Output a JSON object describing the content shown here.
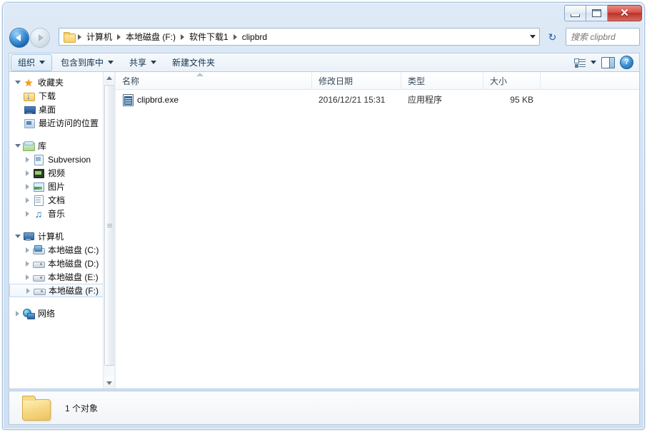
{
  "window": {
    "controls": {
      "minimize": "–",
      "maximize": "□",
      "close": "✕"
    }
  },
  "nav": {
    "back_label": "后退",
    "forward_label": "前进",
    "recent_pages_label": "最近浏览的页面",
    "refresh_label": "刷新",
    "refresh_glyph": "↻",
    "breadcrumb": [
      "计算机",
      "本地磁盘 (F:)",
      "软件下载1",
      "clipbrd"
    ],
    "address_dropdown_label": "地址下拉"
  },
  "search": {
    "placeholder": "搜索 clipbrd",
    "value": ""
  },
  "toolbar": {
    "organize": "组织",
    "include_in_library": "包含到库中",
    "share": "共享",
    "new_folder": "新建文件夹",
    "view_label": "视图",
    "preview_pane_label": "预览窗格",
    "help_label": "?"
  },
  "sidebar": {
    "groups": [
      {
        "header": {
          "label": "收藏夹",
          "icon": "star-icon",
          "expanded": true
        },
        "items": [
          {
            "label": "下载",
            "icon": "download-folder-icon",
            "expandable": false
          },
          {
            "label": "桌面",
            "icon": "desktop-icon",
            "expandable": false
          },
          {
            "label": "最近访问的位置",
            "icon": "recent-places-icon",
            "expandable": false
          }
        ]
      },
      {
        "header": {
          "label": "库",
          "icon": "library-icon",
          "expanded": true
        },
        "items": [
          {
            "label": "Subversion",
            "icon": "subversion-icon",
            "expandable": true
          },
          {
            "label": "视频",
            "icon": "video-icon",
            "expandable": true
          },
          {
            "label": "图片",
            "icon": "picture-icon",
            "expandable": true
          },
          {
            "label": "文档",
            "icon": "document-icon",
            "expandable": true
          },
          {
            "label": "音乐",
            "icon": "music-icon",
            "expandable": true
          }
        ]
      },
      {
        "header": {
          "label": "计算机",
          "icon": "computer-icon",
          "expanded": true
        },
        "items": [
          {
            "label": "本地磁盘 (C:)",
            "icon": "system-drive-icon",
            "expandable": true
          },
          {
            "label": "本地磁盘 (D:)",
            "icon": "drive-icon",
            "expandable": true
          },
          {
            "label": "本地磁盘 (E:)",
            "icon": "drive-icon",
            "expandable": true
          },
          {
            "label": "本地磁盘 (F:)",
            "icon": "drive-icon",
            "expandable": true,
            "selected": true
          }
        ]
      },
      {
        "header": {
          "label": "网络",
          "icon": "network-icon",
          "expanded": false
        },
        "items": []
      }
    ]
  },
  "filelist": {
    "columns": [
      {
        "key": "name",
        "label": "名称",
        "sorted": "asc"
      },
      {
        "key": "date",
        "label": "修改日期"
      },
      {
        "key": "type",
        "label": "类型"
      },
      {
        "key": "size",
        "label": "大小"
      }
    ],
    "rows": [
      {
        "name": "clipbrd.exe",
        "date": "2016/12/21 15:31",
        "type": "应用程序",
        "size": "95 KB",
        "icon": "clipboard-exe-icon"
      }
    ]
  },
  "statusbar": {
    "text": "1 个对象",
    "icon": "folder-icon"
  },
  "colors": {
    "frame": "#d4e3f4",
    "close_button": "#c0392b",
    "accent": "#2b6cb0",
    "folder_yellow": "#f5cc64"
  }
}
